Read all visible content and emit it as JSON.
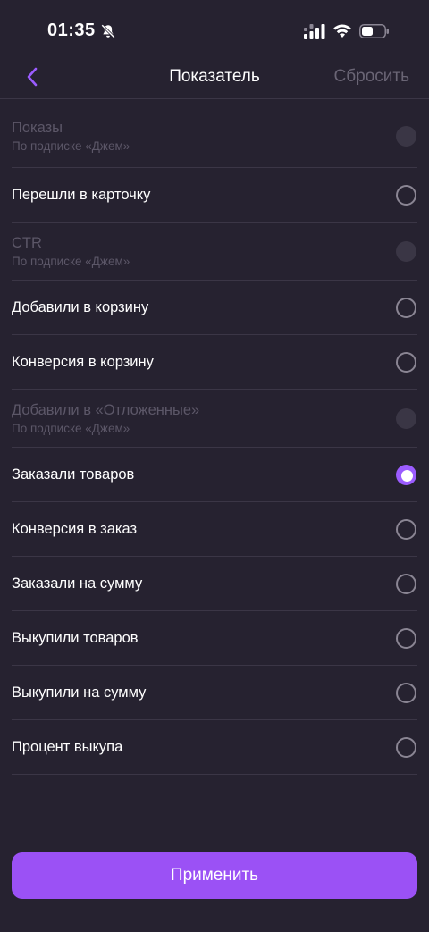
{
  "status_bar": {
    "time": "01:35",
    "icons": [
      "bell-off-icon",
      "signal-icon",
      "wifi-icon",
      "battery-icon"
    ]
  },
  "nav": {
    "back_icon": "chevron-left-icon",
    "title": "Показатель",
    "reset_label": "Сбросить"
  },
  "colors": {
    "background": "#262230",
    "accent": "#9b51f5",
    "disabled_text": "#5c5768",
    "divider": "#3b3646"
  },
  "options": [
    {
      "label": "Показы",
      "sub": "По подписке «Джем»",
      "state": "disabled"
    },
    {
      "label": "Перешли в карточку",
      "state": "unchecked"
    },
    {
      "label": "CTR",
      "sub": "По подписке «Джем»",
      "state": "disabled"
    },
    {
      "label": "Добавили в корзину",
      "state": "unchecked"
    },
    {
      "label": "Конверсия в корзину",
      "state": "unchecked"
    },
    {
      "label": "Добавили в «Отложенные»",
      "sub": "По подписке «Джем»",
      "state": "disabled"
    },
    {
      "label": "Заказали товаров",
      "state": "checked"
    },
    {
      "label": "Конверсия в заказ",
      "state": "unchecked"
    },
    {
      "label": "Заказали на сумму",
      "state": "unchecked"
    },
    {
      "label": "Выкупили товаров",
      "state": "unchecked"
    },
    {
      "label": "Выкупили на сумму",
      "state": "unchecked"
    },
    {
      "label": "Процент выкупа",
      "state": "unchecked"
    }
  ],
  "apply_label": "Применить"
}
